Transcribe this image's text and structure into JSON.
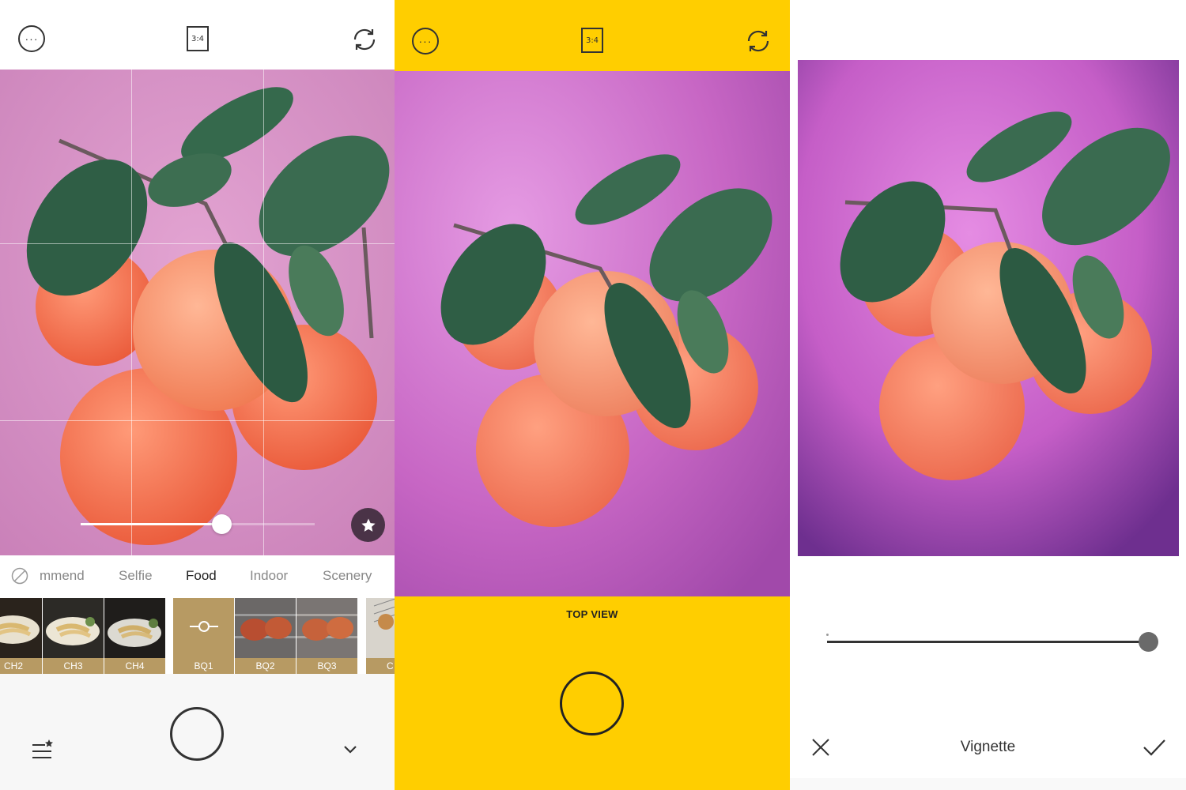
{
  "panel_camera": {
    "top_bar": {
      "more_icon": "more-icon",
      "ratio_label": "3:4",
      "switch_icon": "switch-camera-icon"
    },
    "intensity_slider": {
      "value": 0.6
    },
    "favorite_icon": "star-icon",
    "categories": {
      "none_icon": "no-filter-icon",
      "items": [
        "mmend",
        "Selfie",
        "Food",
        "Indoor",
        "Scenery"
      ],
      "active": "Food"
    },
    "filters": [
      {
        "label": "CH2"
      },
      {
        "label": "CH3"
      },
      {
        "label": "CH4"
      },
      {
        "label": "BQ1",
        "selected": true
      },
      {
        "label": "BQ2"
      },
      {
        "label": "BQ3"
      },
      {
        "label": "C"
      }
    ],
    "bottom": {
      "menu_icon": "filter-list-icon",
      "chevron_icon": "chevron-down-icon"
    }
  },
  "panel_topview": {
    "top_bar": {
      "more_icon": "more-icon",
      "ratio_label": "3:4",
      "switch_icon": "switch-camera-icon"
    },
    "mode_label": "TOP VIEW",
    "accent_color": "#ffce00"
  },
  "panel_edit": {
    "vignette_slider": {
      "value": 1.0
    },
    "tool_name": "Vignette",
    "cancel_icon": "close-icon",
    "confirm_icon": "check-icon"
  }
}
